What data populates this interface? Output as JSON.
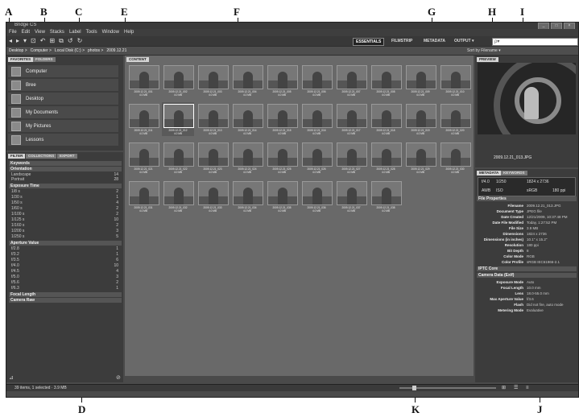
{
  "callouts": {
    "a": "A",
    "b": "B",
    "c": "C",
    "d": "D",
    "e": "E",
    "f": "F",
    "g": "G",
    "h": "H",
    "i": "I",
    "j": "J",
    "k": "K"
  },
  "window": {
    "title": "Bridge CS",
    "controls": [
      "_",
      "□",
      "×"
    ]
  },
  "menu": [
    "File",
    "Edit",
    "View",
    "Stacks",
    "Label",
    "Tools",
    "Window",
    "Help"
  ],
  "workspaces": {
    "essentials": "ESSENTIALS",
    "filmstrip": "FILMSTRIP",
    "metadata": "METADATA",
    "output": "OUTPUT ▾"
  },
  "search": {
    "placeholder": "ρ▾"
  },
  "path": {
    "crumbs": [
      "Desktop >",
      "Computer >",
      "Local Disk (C:) >",
      "photos >",
      "2009.12.21"
    ],
    "sort": "Sort by Filename ▾"
  },
  "favorites_panel": {
    "tabs": [
      "FAVORITES",
      "FOLDERS"
    ],
    "items": [
      "Computer",
      "Bree",
      "Desktop",
      "My Documents",
      "My Pictures",
      "Lessons"
    ]
  },
  "filter_panel": {
    "tabs": [
      "FILTER",
      "COLLECTIONS",
      "EXPORT"
    ],
    "keywords": "Keywords",
    "orientation": {
      "title": "Orientation",
      "rows": [
        [
          "Landscape",
          "14"
        ],
        [
          "Portrait",
          "28"
        ]
      ]
    },
    "exposure": {
      "title": "Exposure Time",
      "rows": [
        [
          "1/8 s",
          "2"
        ],
        [
          "1/30 s",
          "1"
        ],
        [
          "1/50 s",
          "4"
        ],
        [
          "1/60 s",
          "2"
        ],
        [
          "1/100 s",
          "2"
        ],
        [
          "1/125 s",
          "10"
        ],
        [
          "1/160 s",
          "2"
        ],
        [
          "1/200 s",
          "3"
        ],
        [
          "1/250 s",
          "5"
        ]
      ]
    },
    "aperture": {
      "title": "Aperture Value",
      "rows": [
        [
          "f/2.8",
          "1"
        ],
        [
          "f/3.2",
          "1"
        ],
        [
          "f/3.5",
          "6"
        ],
        [
          "f/4.0",
          "10"
        ],
        [
          "f/4.5",
          "4"
        ],
        [
          "f/5.0",
          "3"
        ],
        [
          "f/5.6",
          "2"
        ],
        [
          "f/6.3",
          "1"
        ]
      ]
    },
    "focal": "Focal Length",
    "camera": "Camera Raw"
  },
  "content": {
    "tab": "CONTENT",
    "thumbs": [
      [
        "2009.12.21_001",
        "2009.12.21_002",
        "2009.12.21_003",
        "2009.12.21_004",
        "2009.12.21_005",
        "2009.12.21_006",
        "2009.12.21_007",
        "2009.12.21_008",
        "2009.12.21_009",
        "2009.12.21_010"
      ],
      [
        "2009.12.21_011",
        "2009.12.21_012",
        "2009.12.21_013",
        "2009.12.21_014",
        "2009.12.21_015",
        "2009.12.21_016",
        "2009.12.21_017",
        "2009.12.21_018",
        "2009.12.21_019",
        "2009.12.21_020"
      ],
      [
        "2009.12.21_021",
        "2009.12.21_022",
        "2009.12.21_023",
        "2009.12.21_024",
        "2009.12.21_025",
        "2009.12.21_026",
        "2009.12.21_027",
        "2009.12.21_028",
        "2009.12.21_029",
        "2009.12.21_030"
      ],
      [
        "2009.12.21_031",
        "2009.12.21_032",
        "2009.12.21_033",
        "2009.12.21_034",
        "2009.12.21_035",
        "2009.12.21_036",
        "2009.12.21_037",
        "2009.12.21_038"
      ]
    ],
    "subcaption": "4.0 MB"
  },
  "preview": {
    "tab": "PREVIEW",
    "caption": "2009.12.21_013.JPG"
  },
  "metadata_panel": {
    "tabs": [
      "METADATA",
      "KEYWORDS"
    ],
    "camera_quick": [
      "f/4.0",
      "1/250",
      "1824 x 2736",
      "AWB",
      "ISO",
      "sRGB",
      "180 ppi"
    ],
    "file_props_title": "File Properties",
    "file_props": [
      [
        "Filename",
        "2009.12.21_013.JPG"
      ],
      [
        "Document Type",
        "JPEG file"
      ],
      [
        "Date Created",
        "12/21/2009, 10:37:48 PM"
      ],
      [
        "Date File Modified",
        "Today, 1:27:52 PM"
      ],
      [
        "File Size",
        "3.9 MB"
      ],
      [
        "Dimensions",
        "1824 x 2736"
      ],
      [
        "Dimensions (in inches)",
        "10.1\" x 15.2\""
      ],
      [
        "Resolution",
        "180 ppi"
      ],
      [
        "Bit Depth",
        "8"
      ],
      [
        "Color Mode",
        "RGB"
      ],
      [
        "Color Profile",
        "sRGB IEC61966-2.1"
      ]
    ],
    "iptc": "IPTC Core",
    "camera_title": "Camera Data (Exif)",
    "camera_rows": [
      [
        "Exposure Mode",
        "Auto"
      ],
      [
        "Focal Length",
        "10.0 mm"
      ],
      [
        "Lens",
        "18.0-55.0 mm"
      ],
      [
        "Max Aperture Value",
        "f/3.6"
      ],
      [
        "Flash",
        "Did not fire, auto mode"
      ],
      [
        "Metering Mode",
        "Evaluative"
      ]
    ]
  },
  "status": {
    "text": "39 items, 1 selected · 3.9 MB"
  }
}
